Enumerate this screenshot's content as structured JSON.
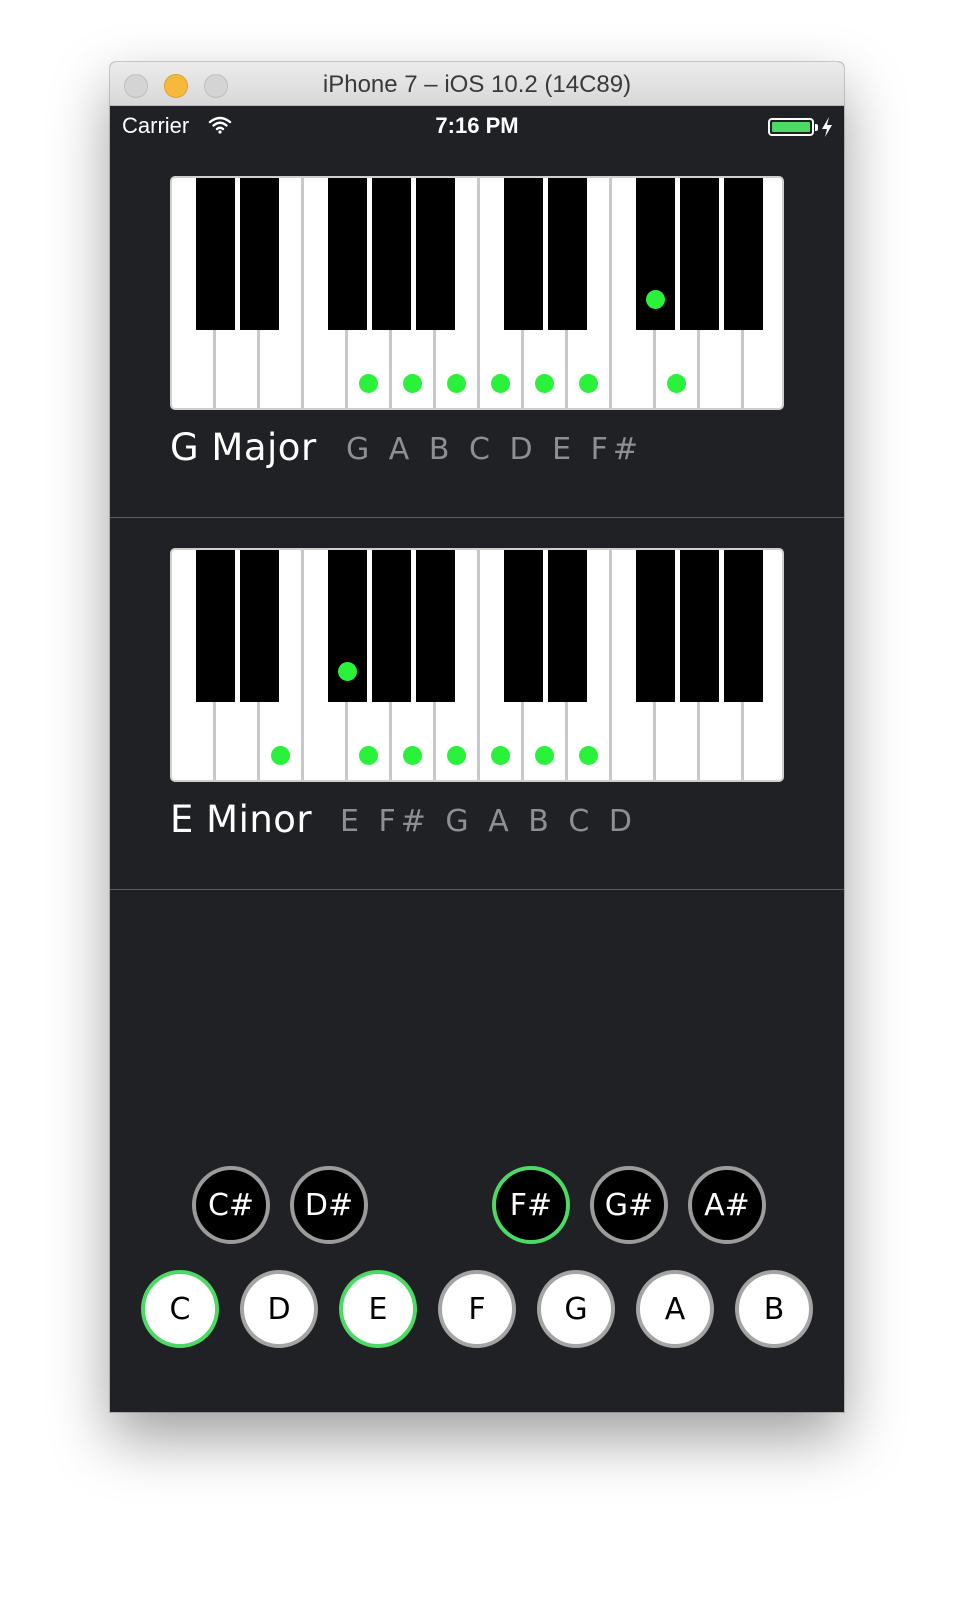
{
  "window": {
    "title": "iPhone 7 – iOS 10.2 (14C89)"
  },
  "status_bar": {
    "carrier": "Carrier",
    "time": "7:16 PM"
  },
  "colors": {
    "highlight": "#2af13a",
    "selected_ring": "#4cd964",
    "background": "#202124"
  },
  "scales": [
    {
      "name": "G Major",
      "notes": "G A B C D E F#",
      "highlighted_white_keys": [
        4,
        5,
        6,
        7,
        8,
        9,
        11
      ],
      "highlighted_black_keys": [
        7
      ]
    },
    {
      "name": "E Minor",
      "notes": "E F# G A B C D",
      "highlighted_white_keys": [
        2,
        4,
        5,
        6,
        7,
        8,
        9
      ],
      "highlighted_black_keys": [
        2
      ]
    }
  ],
  "note_selector": {
    "sharps": [
      {
        "label": "C#",
        "selected": false
      },
      {
        "label": "D#",
        "selected": false
      },
      {
        "label": "F#",
        "selected": true
      },
      {
        "label": "G#",
        "selected": false
      },
      {
        "label": "A#",
        "selected": false
      }
    ],
    "naturals": [
      {
        "label": "C",
        "selected": true
      },
      {
        "label": "D",
        "selected": false
      },
      {
        "label": "E",
        "selected": true
      },
      {
        "label": "F",
        "selected": false
      },
      {
        "label": "G",
        "selected": false
      },
      {
        "label": "A",
        "selected": false
      },
      {
        "label": "B",
        "selected": false
      }
    ]
  }
}
